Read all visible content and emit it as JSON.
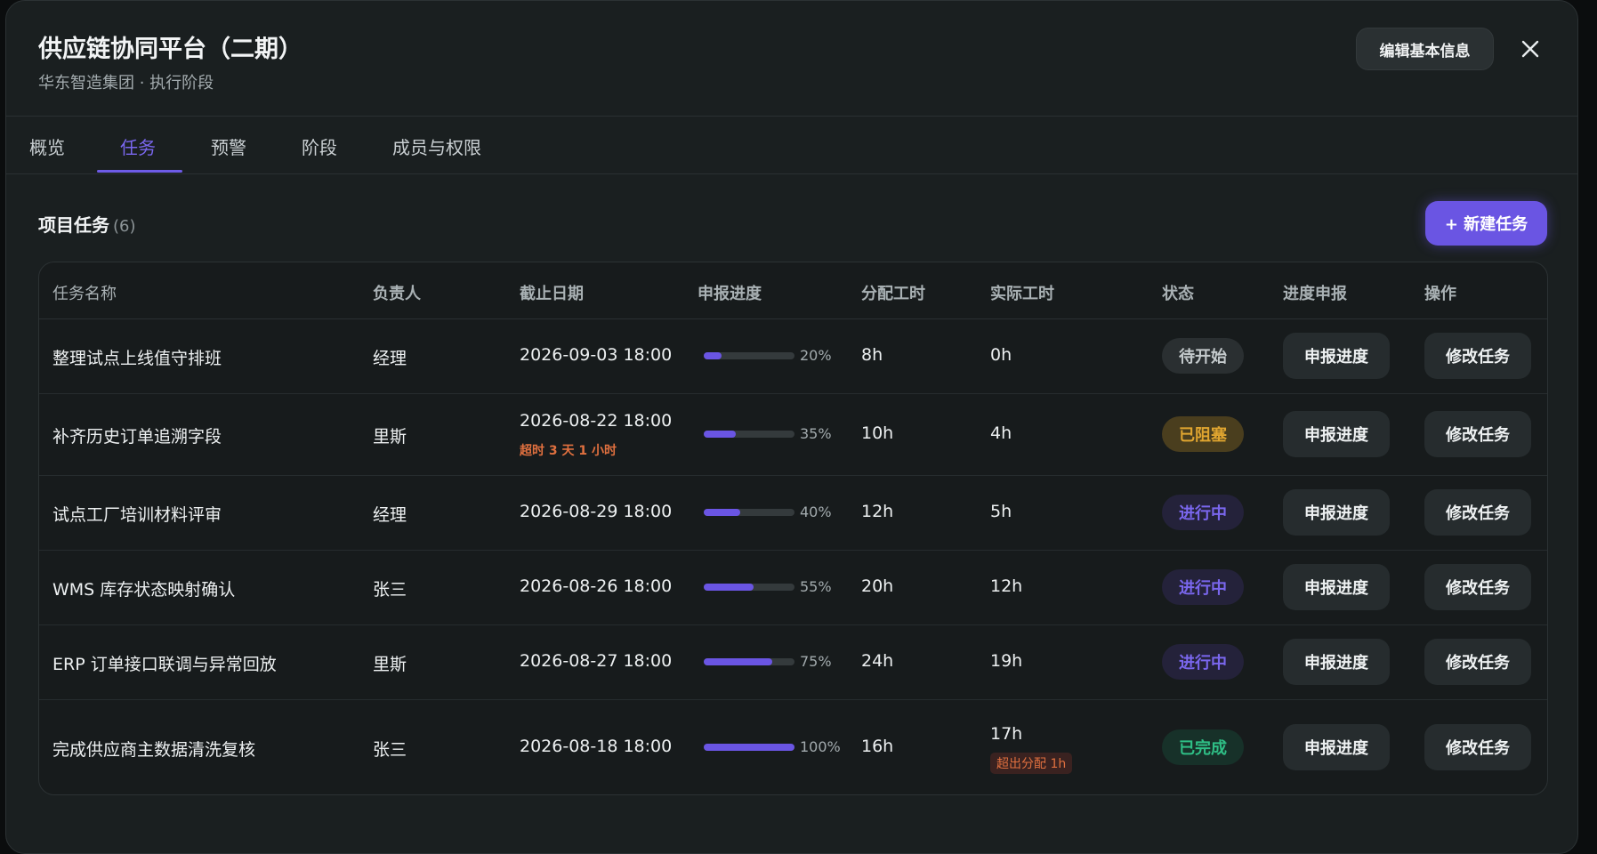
{
  "header": {
    "title": "供应链协同平台（二期）",
    "subtitle": "华东智造集团 · 执行阶段",
    "edit_label": "编辑基本信息"
  },
  "tabs": [
    {
      "label": "概览",
      "active": false
    },
    {
      "label": "任务",
      "active": true
    },
    {
      "label": "预警",
      "active": false
    },
    {
      "label": "阶段",
      "active": false
    },
    {
      "label": "成员与权限",
      "active": false
    }
  ],
  "section": {
    "title": "项目任务",
    "count": "(6)",
    "new_button": "+ 新建任务"
  },
  "columns": {
    "name": "任务名称",
    "owner": "负责人",
    "due": "截止日期",
    "progress": "申报进度",
    "allocated": "分配工时",
    "actual": "实际工时",
    "status": "状态",
    "report": "进度申报",
    "ops": "操作"
  },
  "tasks": [
    {
      "name": "整理试点上线值守排班",
      "owner": "经理",
      "due": "2026-09-03 18:00",
      "due_note": "",
      "progress": 20,
      "progress_label": "20%",
      "allocated": "8h",
      "actual": "0h",
      "actual_note": "",
      "status": "待开始",
      "status_kind": "pending",
      "report_label": "申报进度",
      "edit_label": "修改任务"
    },
    {
      "name": "补齐历史订单追溯字段",
      "owner": "里斯",
      "due": "2026-08-22 18:00",
      "due_note": "超时 3 天 1 小时",
      "progress": 35,
      "progress_label": "35%",
      "allocated": "10h",
      "actual": "4h",
      "actual_note": "",
      "status": "已阻塞",
      "status_kind": "blocked",
      "report_label": "申报进度",
      "edit_label": "修改任务"
    },
    {
      "name": "试点工厂培训材料评审",
      "owner": "经理",
      "due": "2026-08-29 18:00",
      "due_note": "",
      "progress": 40,
      "progress_label": "40%",
      "allocated": "12h",
      "actual": "5h",
      "actual_note": "",
      "status": "进行中",
      "status_kind": "active",
      "report_label": "申报进度",
      "edit_label": "修改任务"
    },
    {
      "name": "WMS 库存状态映射确认",
      "owner": "张三",
      "due": "2026-08-26 18:00",
      "due_note": "",
      "progress": 55,
      "progress_label": "55%",
      "allocated": "20h",
      "actual": "12h",
      "actual_note": "",
      "status": "进行中",
      "status_kind": "active",
      "report_label": "申报进度",
      "edit_label": "修改任务"
    },
    {
      "name": "ERP 订单接口联调与异常回放",
      "owner": "里斯",
      "due": "2026-08-27 18:00",
      "due_note": "",
      "progress": 75,
      "progress_label": "75%",
      "allocated": "24h",
      "actual": "19h",
      "actual_note": "",
      "status": "进行中",
      "status_kind": "active",
      "report_label": "申报进度",
      "edit_label": "修改任务"
    },
    {
      "name": "完成供应商主数据清洗复核",
      "owner": "张三",
      "due": "2026-08-18 18:00",
      "due_note": "",
      "progress": 100,
      "progress_label": "100%",
      "allocated": "16h",
      "actual": "17h",
      "actual_note": "超出分配 1h",
      "status": "已完成",
      "status_kind": "done",
      "report_label": "申报进度",
      "edit_label": "修改任务"
    }
  ],
  "colors": {
    "accent": "#6a55e3",
    "pending_bg": "#2a2f31",
    "pending_fg": "#c4cacc",
    "blocked_bg": "#4a3e1e",
    "blocked_fg": "#e0a530",
    "active_bg": "#24223a",
    "active_fg": "#7a67ee",
    "done_bg": "#173129",
    "done_fg": "#2fbf86"
  }
}
